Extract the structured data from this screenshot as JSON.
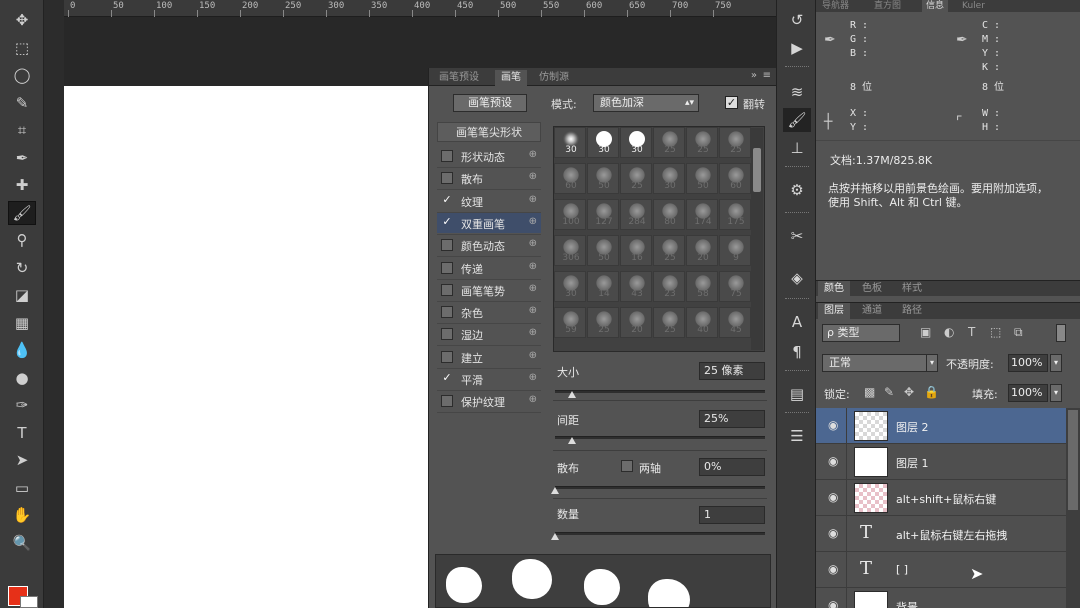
{
  "colors": {
    "foreground": "#e63018",
    "background": "#ffffff",
    "selected_layer": "#4c6791",
    "panel": "#535353"
  },
  "ruler": {
    "labels": [
      "0",
      "50",
      "100",
      "150",
      "200",
      "250",
      "300",
      "350",
      "400",
      "450",
      "500",
      "550",
      "600",
      "650",
      "700",
      "750"
    ]
  },
  "toolbar": {
    "tools": [
      {
        "name": "move-tool",
        "glyph": "✥"
      },
      {
        "name": "marquee-tool",
        "glyph": "⬚"
      },
      {
        "name": "lasso-tool",
        "glyph": "◯"
      },
      {
        "name": "quick-select-tool",
        "glyph": "✎"
      },
      {
        "name": "crop-tool",
        "glyph": "⌗"
      },
      {
        "name": "eyedropper-tool",
        "glyph": "✒"
      },
      {
        "name": "healing-tool",
        "glyph": "✚"
      },
      {
        "name": "brush-tool",
        "glyph": "🖌"
      },
      {
        "name": "stamp-tool",
        "glyph": "⚲"
      },
      {
        "name": "history-brush-tool",
        "glyph": "↻"
      },
      {
        "name": "eraser-tool",
        "glyph": "◪"
      },
      {
        "name": "gradient-tool",
        "glyph": "▦"
      },
      {
        "name": "blur-tool",
        "glyph": "💧"
      },
      {
        "name": "dodge-tool",
        "glyph": "●"
      },
      {
        "name": "pen-tool",
        "glyph": "✑"
      },
      {
        "name": "type-tool",
        "glyph": "T"
      },
      {
        "name": "path-select-tool",
        "glyph": "➤"
      },
      {
        "name": "shape-tool",
        "glyph": "▭"
      },
      {
        "name": "hand-tool",
        "glyph": "✋"
      },
      {
        "name": "zoom-tool",
        "glyph": "🔍"
      }
    ]
  },
  "brush_panel": {
    "tabs": [
      "画笔预设",
      "画笔",
      "仿制源"
    ],
    "collapse": "»",
    "menu": "≡",
    "presets_button": "画笔预设",
    "mode_label": "模式:",
    "mode_value": "颜色加深",
    "flip_label": "翻转",
    "tip_shape": "画笔笔尖形状",
    "options": [
      {
        "label": "形状动态",
        "checked": false
      },
      {
        "label": "散布",
        "checked": false
      },
      {
        "label": "纹理",
        "checked": true
      },
      {
        "label": "双重画笔",
        "checked": true
      },
      {
        "label": "颜色动态",
        "checked": false
      },
      {
        "label": "传递",
        "checked": false
      },
      {
        "label": "画笔笔势",
        "checked": false
      },
      {
        "label": "杂色",
        "checked": false
      },
      {
        "label": "湿边",
        "checked": false
      },
      {
        "label": "建立",
        "checked": false
      },
      {
        "label": "平滑",
        "checked": true
      },
      {
        "label": "保护纹理",
        "checked": false
      }
    ],
    "tips": [
      {
        "size": "30",
        "style": "soft",
        "active": true
      },
      {
        "size": "30",
        "style": "solid",
        "active": true
      },
      {
        "size": "30",
        "style": "solid",
        "active": true
      },
      {
        "size": "25",
        "style": "dim"
      },
      {
        "size": "25",
        "style": "dim"
      },
      {
        "size": "25",
        "style": "dim"
      },
      {
        "size": "60",
        "style": "dim"
      },
      {
        "size": "50",
        "style": "dim"
      },
      {
        "size": "25",
        "style": "dim"
      },
      {
        "size": "30",
        "style": "dim"
      },
      {
        "size": "50",
        "style": "dim"
      },
      {
        "size": "60",
        "style": "dim"
      },
      {
        "size": "100",
        "style": "dim"
      },
      {
        "size": "127",
        "style": "dim"
      },
      {
        "size": "284",
        "style": "dim"
      },
      {
        "size": "80",
        "style": "dim"
      },
      {
        "size": "174",
        "style": "dim"
      },
      {
        "size": "175",
        "style": "dim"
      },
      {
        "size": "306",
        "style": "dim"
      },
      {
        "size": "50",
        "style": "dim"
      },
      {
        "size": "16",
        "style": "dim"
      },
      {
        "size": "25",
        "style": "dim"
      },
      {
        "size": "20",
        "style": "dim"
      },
      {
        "size": "9",
        "style": "dim"
      },
      {
        "size": "30",
        "style": "dim"
      },
      {
        "size": "14",
        "style": "dim"
      },
      {
        "size": "43",
        "style": "dim"
      },
      {
        "size": "23",
        "style": "dim"
      },
      {
        "size": "58",
        "style": "dim"
      },
      {
        "size": "75",
        "style": "dim"
      },
      {
        "size": "59",
        "style": "dim"
      },
      {
        "size": "25",
        "style": "dim"
      },
      {
        "size": "20",
        "style": "dim"
      },
      {
        "size": "25",
        "style": "dim"
      },
      {
        "size": "40",
        "style": "dim"
      },
      {
        "size": "45",
        "style": "dim"
      }
    ],
    "size_label": "大小",
    "size_value": "25 像素",
    "size_level": 0.08,
    "spacing_label": "间距",
    "spacing_value": "25%",
    "spacing_level": 0.08,
    "scatter_label": "散布",
    "both_axes_label": "两轴",
    "scatter_value": "0%",
    "scatter_level": 0.0,
    "count_label": "数量",
    "count_value": "1",
    "count_level": 0.0
  },
  "strip": {
    "icons": [
      "history-icon",
      "actions-icon",
      "adjust-icon",
      "brush-icon",
      "stamp-icon",
      "styles-icon",
      "tools-icon",
      "3d-icon",
      "character-icon",
      "paragraph-icon",
      "notes-icon",
      "properties-icon"
    ],
    "glyphs": [
      "↺",
      "▶",
      "≋",
      "🖌",
      "⊥",
      "⚙",
      "✂",
      "◈",
      "A",
      "¶",
      "▤",
      "☰"
    ]
  },
  "info_panel": {
    "tabs": [
      "导航器",
      "直方图",
      "信息",
      "Kuler"
    ],
    "rgb": [
      "R :",
      "G :",
      "B :"
    ],
    "bit_left": "8 位",
    "cmyk": [
      "C :",
      "M :",
      "Y :",
      "K :"
    ],
    "bit_right": "8 位",
    "xy": [
      "X :",
      "Y :"
    ],
    "wh": [
      "W :",
      "H :"
    ],
    "doc": "文档:1.37M/825.8K",
    "hint": "点按并拖移以用前景色绘画。要用附加选项，使用 Shift、Alt 和 Ctrl 键。"
  },
  "color_tabs": [
    "颜色",
    "色板",
    "样式"
  ],
  "layers_panel": {
    "tabs": [
      "图层",
      "通道",
      "路径"
    ],
    "kind": "ρ 类型",
    "blend_mode": "正常",
    "opacity_label": "不透明度:",
    "opacity_value": "100%",
    "lock_label": "锁定:",
    "fill_label": "填充:",
    "fill_value": "100%",
    "layers": [
      {
        "name": "图层 2",
        "thumb": "checker",
        "selected": true
      },
      {
        "name": "图层 1",
        "thumb": "white",
        "selected": false
      },
      {
        "name": "alt+shift+鼠标右键",
        "thumb": "pinkchecker",
        "selected": false
      },
      {
        "name": "alt+鼠标右键左右拖拽",
        "thumb": "text",
        "selected": false
      },
      {
        "name": "[ ]",
        "thumb": "text",
        "selected": false
      },
      {
        "name": "背景",
        "thumb": "white",
        "selected": false
      }
    ]
  }
}
